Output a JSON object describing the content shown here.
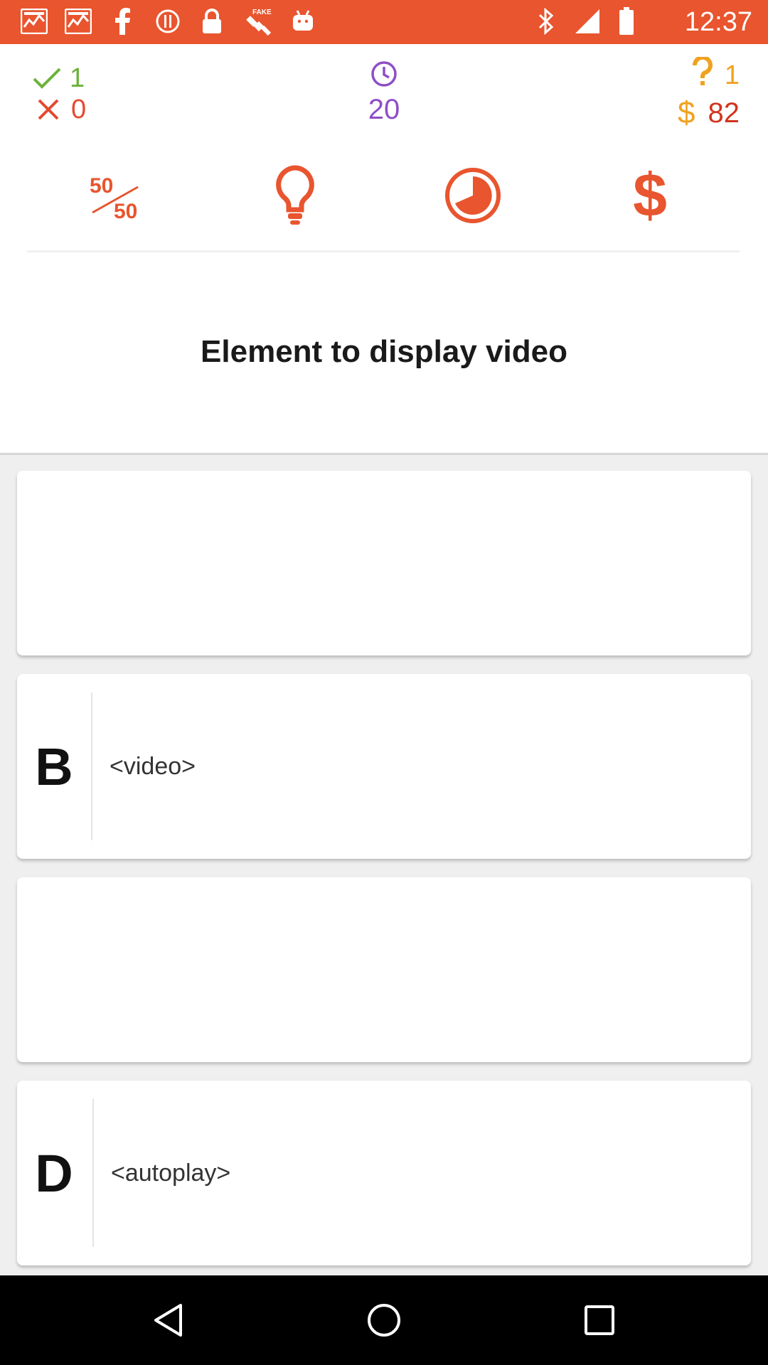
{
  "status_bar": {
    "time": "12:37",
    "left_icons": [
      "iifl-markets-icon",
      "iifl-markets-icon",
      "facebook-icon",
      "alert-icon",
      "lock-icon",
      "fake-gps-icon",
      "android-debug-icon"
    ],
    "right_icons": [
      "bluetooth-icon",
      "signal-icon",
      "battery-icon"
    ]
  },
  "stats": {
    "correct": "1",
    "wrong": "0",
    "timer": "20",
    "questions": "1",
    "coins": "82",
    "coin_symbol": "$"
  },
  "lifelines": {
    "fifty_top": "50",
    "fifty_bottom": "50",
    "dollar": "$"
  },
  "question": {
    "text": "Element to display video"
  },
  "answers": [
    {
      "letter": "",
      "text": ""
    },
    {
      "letter": "B",
      "text": "<video>"
    },
    {
      "letter": "",
      "text": ""
    },
    {
      "letter": "D",
      "text": "<autoplay>"
    }
  ],
  "colors": {
    "accent": "#e8552e",
    "correct": "#6cb23a",
    "wrong": "#e34a2f",
    "timer": "#8e4ec6",
    "gold": "#f0a21f",
    "coins_value": "#d2341e"
  }
}
